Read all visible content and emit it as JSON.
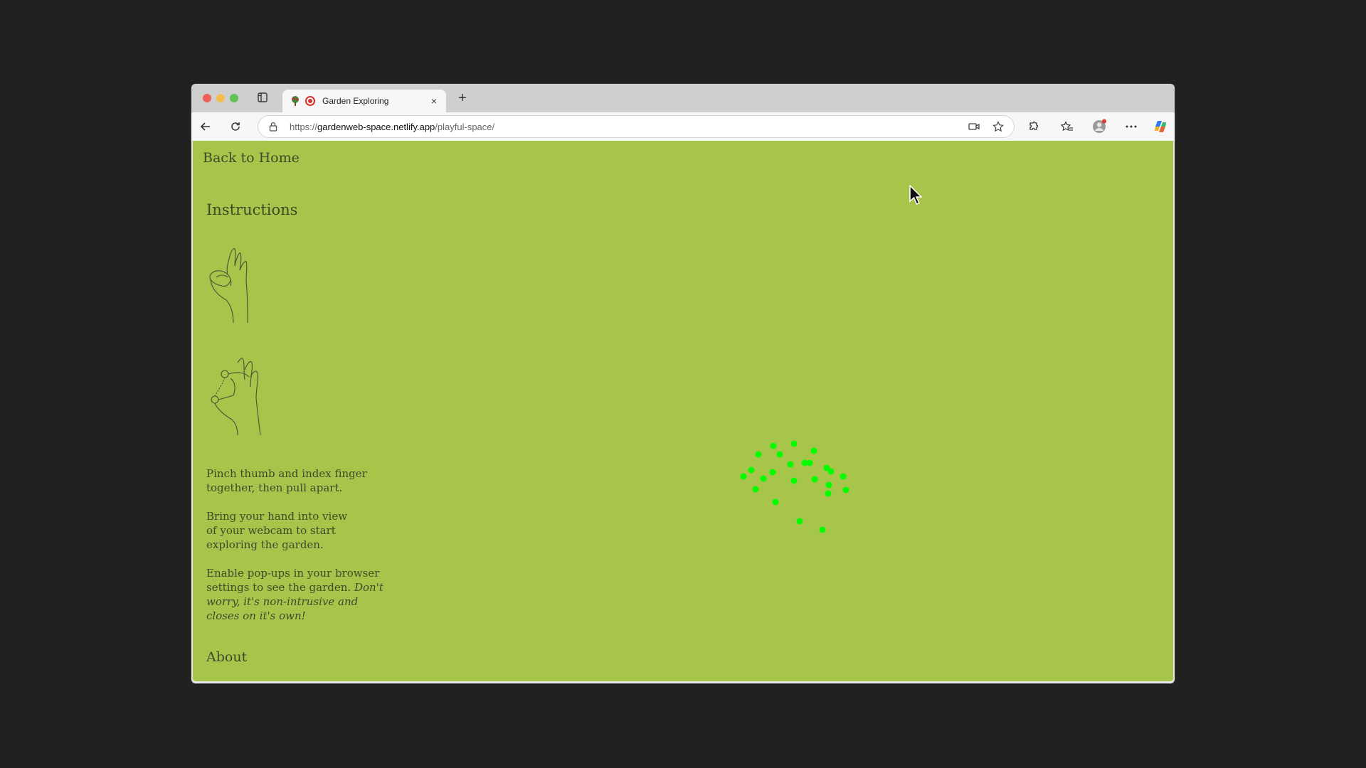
{
  "browser": {
    "tab_title": "Garden Exploring",
    "tab_close": "×",
    "new_tab": "+",
    "url_scheme": "https://",
    "url_host": "gardenweb-space.netlify.app",
    "url_path": "/playful-space/"
  },
  "page": {
    "back_link": "Back to Home",
    "instructions_heading": "Instructions",
    "paragraph1_line1": "Pinch thumb and index finger",
    "paragraph1_line2": "together, then pull apart.",
    "paragraph2_line1": "Bring your hand into view",
    "paragraph2_line2": "of your webcam to start",
    "paragraph2_line3": "exploring the garden.",
    "paragraph3_line1": "Enable pop-ups in your browser",
    "paragraph3_line2": "settings to see the garden.",
    "paragraph3_italic_1": "Don't",
    "paragraph3_italic_2": "worry, it's non-intrusive and",
    "paragraph3_italic_3": "closes on it's own!",
    "about": "About"
  },
  "colors": {
    "page_background": "#a8c54b",
    "text": "#3d4a2a",
    "dot": "#00ff00",
    "recording": "#d93030"
  },
  "icons": {
    "tab_toggle": "sidebar-icon",
    "favicon": "tree-favicon",
    "recording": "recording-icon",
    "back": "back-arrow-icon",
    "reload": "reload-icon",
    "lock": "lock-icon",
    "camera": "camera-icon",
    "favorite": "star-icon",
    "extensions": "puzzle-icon",
    "favorites": "favorites-icon",
    "profile": "profile-icon",
    "more": "more-icon",
    "copilot": "copilot-icon",
    "pinch_hand": "pinch-hand-illustration",
    "spread_hand": "spread-hand-illustration",
    "cursor": "mouse-cursor-icon"
  }
}
